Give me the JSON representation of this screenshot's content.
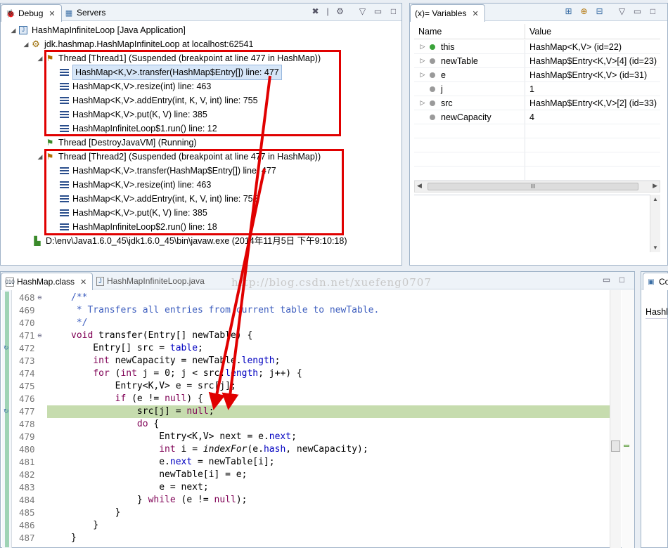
{
  "debug_view": {
    "tabs": [
      {
        "label": "Debug",
        "active": true
      },
      {
        "label": "Servers",
        "active": false
      }
    ],
    "tree": [
      {
        "text": "HashMapInfiniteLoop [Java Application]",
        "level": 0
      },
      {
        "text": "jdk.hashmap.HashMapInfiniteLoop at localhost:62541",
        "level": 1
      },
      {
        "text": "Thread [Thread1] (Suspended (breakpoint at line 477 in HashMap))",
        "level": 2
      },
      {
        "text": "HashMap<K,V>.transfer(HashMap$Entry[]) line: 477",
        "level": 3
      },
      {
        "text": "HashMap<K,V>.resize(int) line: 463",
        "level": 3
      },
      {
        "text": "HashMap<K,V>.addEntry(int, K, V, int) line: 755",
        "level": 3
      },
      {
        "text": "HashMap<K,V>.put(K, V) line: 385",
        "level": 3
      },
      {
        "text": "HashMapInfiniteLoop$1.run() line: 12",
        "level": 3
      },
      {
        "text": "Thread [DestroyJavaVM] (Running)",
        "level": 2
      },
      {
        "text": "Thread [Thread2] (Suspended (breakpoint at line 477 in HashMap))",
        "level": 2
      },
      {
        "text": "HashMap<K,V>.transfer(HashMap$Entry[]) line: 477",
        "level": 3
      },
      {
        "text": "HashMap<K,V>.resize(int) line: 463",
        "level": 3
      },
      {
        "text": "HashMap<K,V>.addEntry(int, K, V, int) line: 755",
        "level": 3
      },
      {
        "text": "HashMap<K,V>.put(K, V) line: 385",
        "level": 3
      },
      {
        "text": "HashMapInfiniteLoop$2.run() line: 18",
        "level": 3
      },
      {
        "text": "D:\\env\\Java1.6.0_45\\jdk1.6.0_45\\bin\\javaw.exe (2014年11月5日 下午9:10:18)",
        "level": 1
      }
    ]
  },
  "variables_view": {
    "tab_label": "(x)= Variables",
    "columns": [
      "Name",
      "Value"
    ],
    "rows": [
      {
        "name": "this",
        "value": "HashMap<K,V>  (id=22)"
      },
      {
        "name": "newTable",
        "value": "HashMap$Entry<K,V>[4]  (id=23)"
      },
      {
        "name": "e",
        "value": "HashMap$Entry<K,V>  (id=31)"
      },
      {
        "name": "j",
        "value": "1"
      },
      {
        "name": "src",
        "value": "HashMap$Entry<K,V>[2]  (id=33)"
      },
      {
        "name": "newCapacity",
        "value": "4"
      }
    ],
    "hscroll_grip": "III"
  },
  "editor": {
    "tabs": [
      {
        "label": "HashMap.class",
        "active": true
      },
      {
        "label": "HashMapInfiniteLoop.java",
        "active": false
      }
    ],
    "watermark": "http://blog.csdn.net/xuefeng0707",
    "line_numbers": [
      "468",
      "469",
      "470",
      "471",
      "472",
      "473",
      "474",
      "475",
      "476",
      "477",
      "478",
      "479",
      "480",
      "481",
      "482",
      "483",
      "484",
      "485",
      "486",
      "487"
    ],
    "highlighted_line": "477"
  },
  "outline_view": {
    "tab_label": "Co",
    "item": "Hashl"
  },
  "colors": {
    "annotation": "#e00000",
    "current_line": "#c6dcae",
    "keyword": "#7f0055",
    "field": "#0000c0",
    "comment": "#3f5fbf"
  }
}
